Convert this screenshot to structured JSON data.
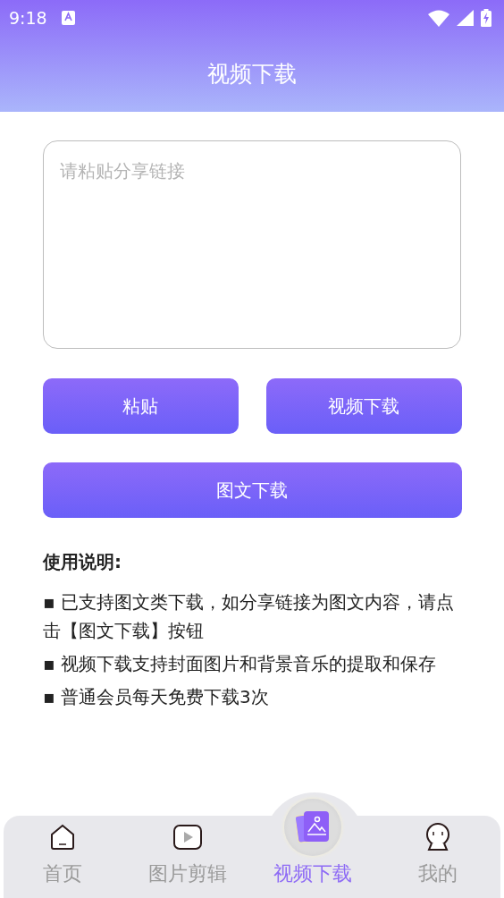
{
  "status_bar": {
    "time": "9:18"
  },
  "header": {
    "title": "视频下载"
  },
  "link_input": {
    "placeholder": "请粘贴分享链接"
  },
  "buttons": [
    {
      "label": "粘贴",
      "kind": "half"
    },
    {
      "label": "视频下载",
      "kind": "half"
    },
    {
      "label": "图文下载",
      "kind": "full"
    }
  ],
  "instructions": {
    "title": "使用说明:",
    "items": [
      "▪  已支持图文类下载，如分享链接为图文内容，请点击【图文下载】按钮",
      "▪  视频下载支持封面图片和背景音乐的提取和保存",
      "▪  普通会员每天免费下载3次"
    ]
  },
  "tab_bar": [
    {
      "label": "首页",
      "selected": false
    },
    {
      "label": "图片剪辑",
      "selected": false
    },
    {
      "label": "视频下载",
      "selected": true
    },
    {
      "label": "我的",
      "selected": false
    }
  ]
}
